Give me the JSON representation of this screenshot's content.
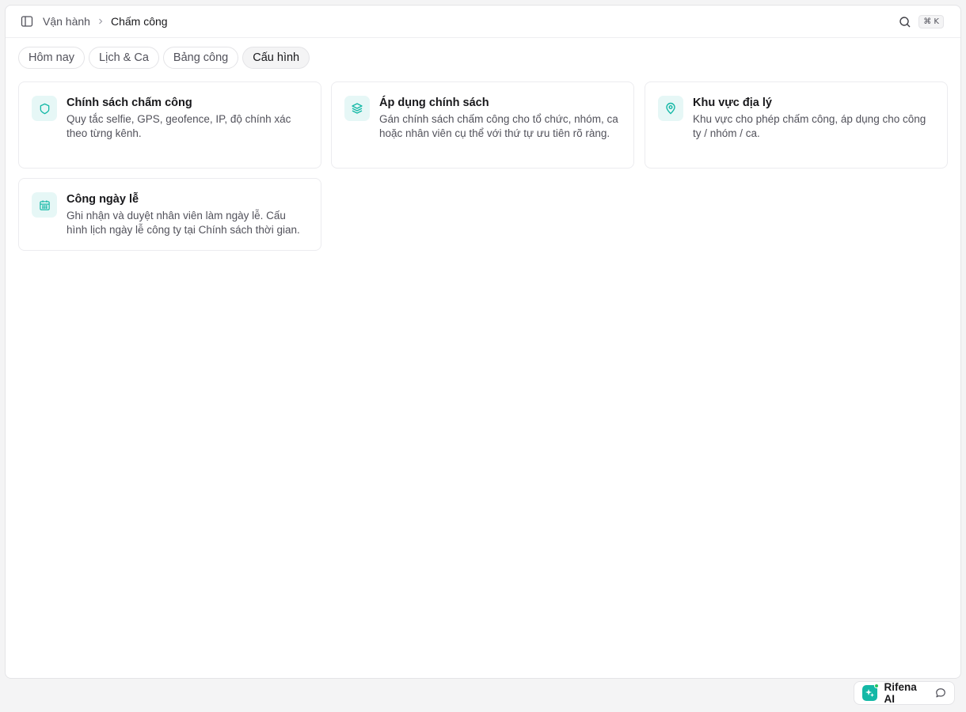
{
  "breadcrumb": {
    "parent": "Vận hành",
    "current": "Chấm công"
  },
  "search": {
    "shortcut": "⌘ K"
  },
  "tabs": [
    {
      "label": "Hôm nay",
      "active": false
    },
    {
      "label": "Lịch & Ca",
      "active": false
    },
    {
      "label": "Bảng công",
      "active": false
    },
    {
      "label": "Cấu hình",
      "active": true
    }
  ],
  "cards": [
    {
      "icon": "shield-icon",
      "title": "Chính sách chấm công",
      "description": "Quy tắc selfie, GPS, geofence, IP, độ chính xác theo từng kênh."
    },
    {
      "icon": "layers-icon",
      "title": "Áp dụng chính sách",
      "description": "Gán chính sách chấm công cho tổ chức, nhóm, ca hoặc nhân viên cụ thể với thứ tự ưu tiên rõ ràng."
    },
    {
      "icon": "map-pin-icon",
      "title": "Khu vực địa lý",
      "description": "Khu vực cho phép chấm công, áp dụng cho công ty / nhóm / ca."
    },
    {
      "icon": "calendar-icon",
      "title": "Công ngày lễ",
      "description": "Ghi nhận và duyệt nhân viên làm ngày lễ. Cấu hình lịch ngày lễ công ty tại Chính sách thời gian."
    }
  ],
  "assistant": {
    "label": "Rifena AI"
  },
  "colors": {
    "accent": "#14b8a6",
    "icon_bg": "#e6f7f6"
  }
}
